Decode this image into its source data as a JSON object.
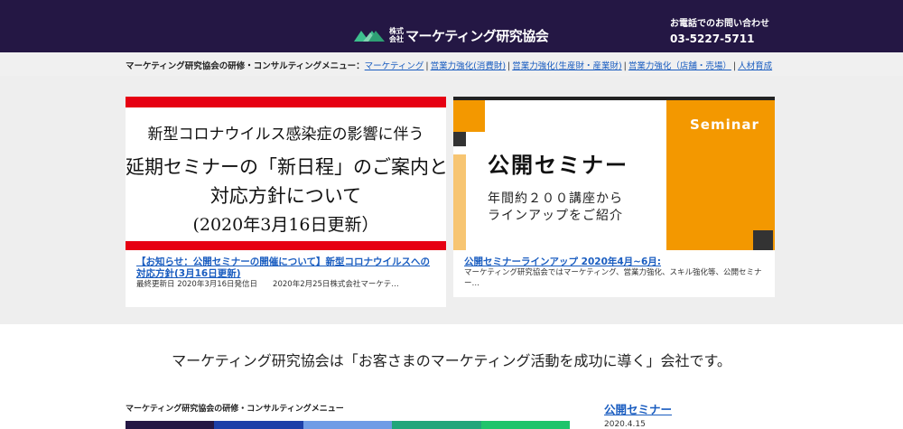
{
  "header": {
    "logo_small": "株式会社",
    "logo_text": "マーケティング研究協会",
    "contact_label": "お電話でのお問い合わせ",
    "contact_phone": "03-5227-5711"
  },
  "menu_bar": {
    "lead": "マーケティング研究協会の研修・コンサルティングメニュー：",
    "items": [
      {
        "label": "マーケティング"
      },
      {
        "label": "営業力強化(消費財)"
      },
      {
        "label": "営業力強化(生産財・産業財)"
      },
      {
        "label": "営業力強化（店舗・売場）"
      },
      {
        "label": "人材育成"
      }
    ],
    "separator": "|"
  },
  "cards": [
    {
      "banner_lines": [
        "新型コロナウイルス感染症の影響に伴う",
        "延期セミナーの「新日程」のご案内と",
        "対応方針について",
        "(2020年3月16日更新）"
      ],
      "title": "【お知らせ：公開セミナーの開催について】新型コロナウイルスへの対応方針(3月16日更新)",
      "description": "最終更新日 2020年3月16日発信日　　2020年2月25日株式会社マーケテ…"
    },
    {
      "banner_seminar": "Seminar",
      "banner_title": "公開セミナー",
      "banner_sub_1": "年間約２００講座から",
      "banner_sub_2": "ラインアップをご紹介",
      "title": "公開セミナーラインアップ 2020年4月~6月:",
      "description": "マーケティング研究協会ではマーケティング、営業力強化、スキル強化等、公開セミナー…"
    }
  ],
  "tagline": "マーケティング研究協会は「お客さまのマーケティング活動を成功に導く」会社です。",
  "lower": {
    "heading": "マーケティング研究協会の研修・コンサルティングメニュー",
    "seminar_link": "公開セミナー",
    "date": "2020.4.15"
  },
  "colors": {
    "header_bg": "#241744",
    "link": "#1a5dc0",
    "red": "#e60012",
    "orange": "#f39800",
    "strip": [
      "#241744",
      "#1c3fa8",
      "#6f9ce6",
      "#21a67a",
      "#1fc46b"
    ]
  }
}
